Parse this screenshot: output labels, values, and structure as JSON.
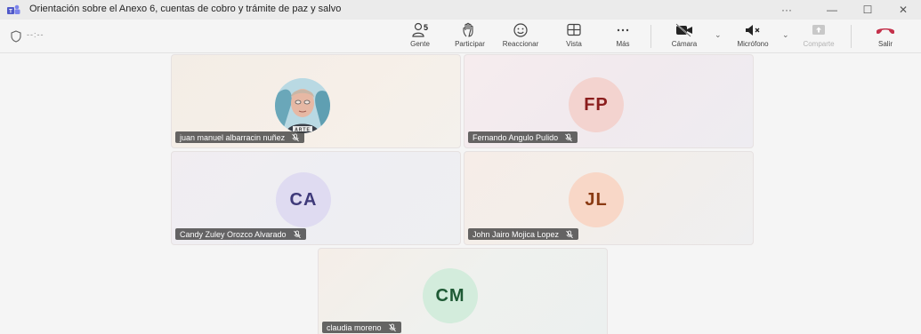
{
  "window": {
    "title": "Orientación sobre el Anexo 6, cuentas de cobro y trámite de paz y salvo",
    "controls": {
      "more": "···",
      "minimize": "—",
      "maximize": "☐",
      "close": "✕"
    }
  },
  "toolbar": {
    "timer": "--:--",
    "people_count": "5",
    "people_label": "Gente",
    "raise_hand_label": "Participar",
    "react_label": "Reaccionar",
    "view_label": "Vista",
    "more_label": "Más",
    "camera_label": "Cámara",
    "mic_label": "Micrófono",
    "share_label": "Comparte",
    "leave_label": "Salir",
    "leave_color": "#c4314b"
  },
  "participants": [
    {
      "name": "juan manuel albarracin nuñez",
      "initials": "",
      "has_photo": true,
      "muted": true
    },
    {
      "name": "Fernando Angulo Pulido",
      "initials": "FP",
      "avatar_bg": "#f3d3cf",
      "text_color": "#8b1d1d",
      "muted": true
    },
    {
      "name": "Candy Zuley Orozco Alvarado",
      "initials": "CA",
      "avatar_bg": "#dfdbf1",
      "text_color": "#3f3a7a",
      "muted": true
    },
    {
      "name": "John Jairo Mojica Lopez",
      "initials": "JL",
      "avatar_bg": "#f8d7c7",
      "text_color": "#8a3a12",
      "muted": true
    },
    {
      "name": "claudia moreno",
      "initials": "CM",
      "avatar_bg": "#d3ecdc",
      "text_color": "#1f5a35",
      "muted": true
    }
  ]
}
